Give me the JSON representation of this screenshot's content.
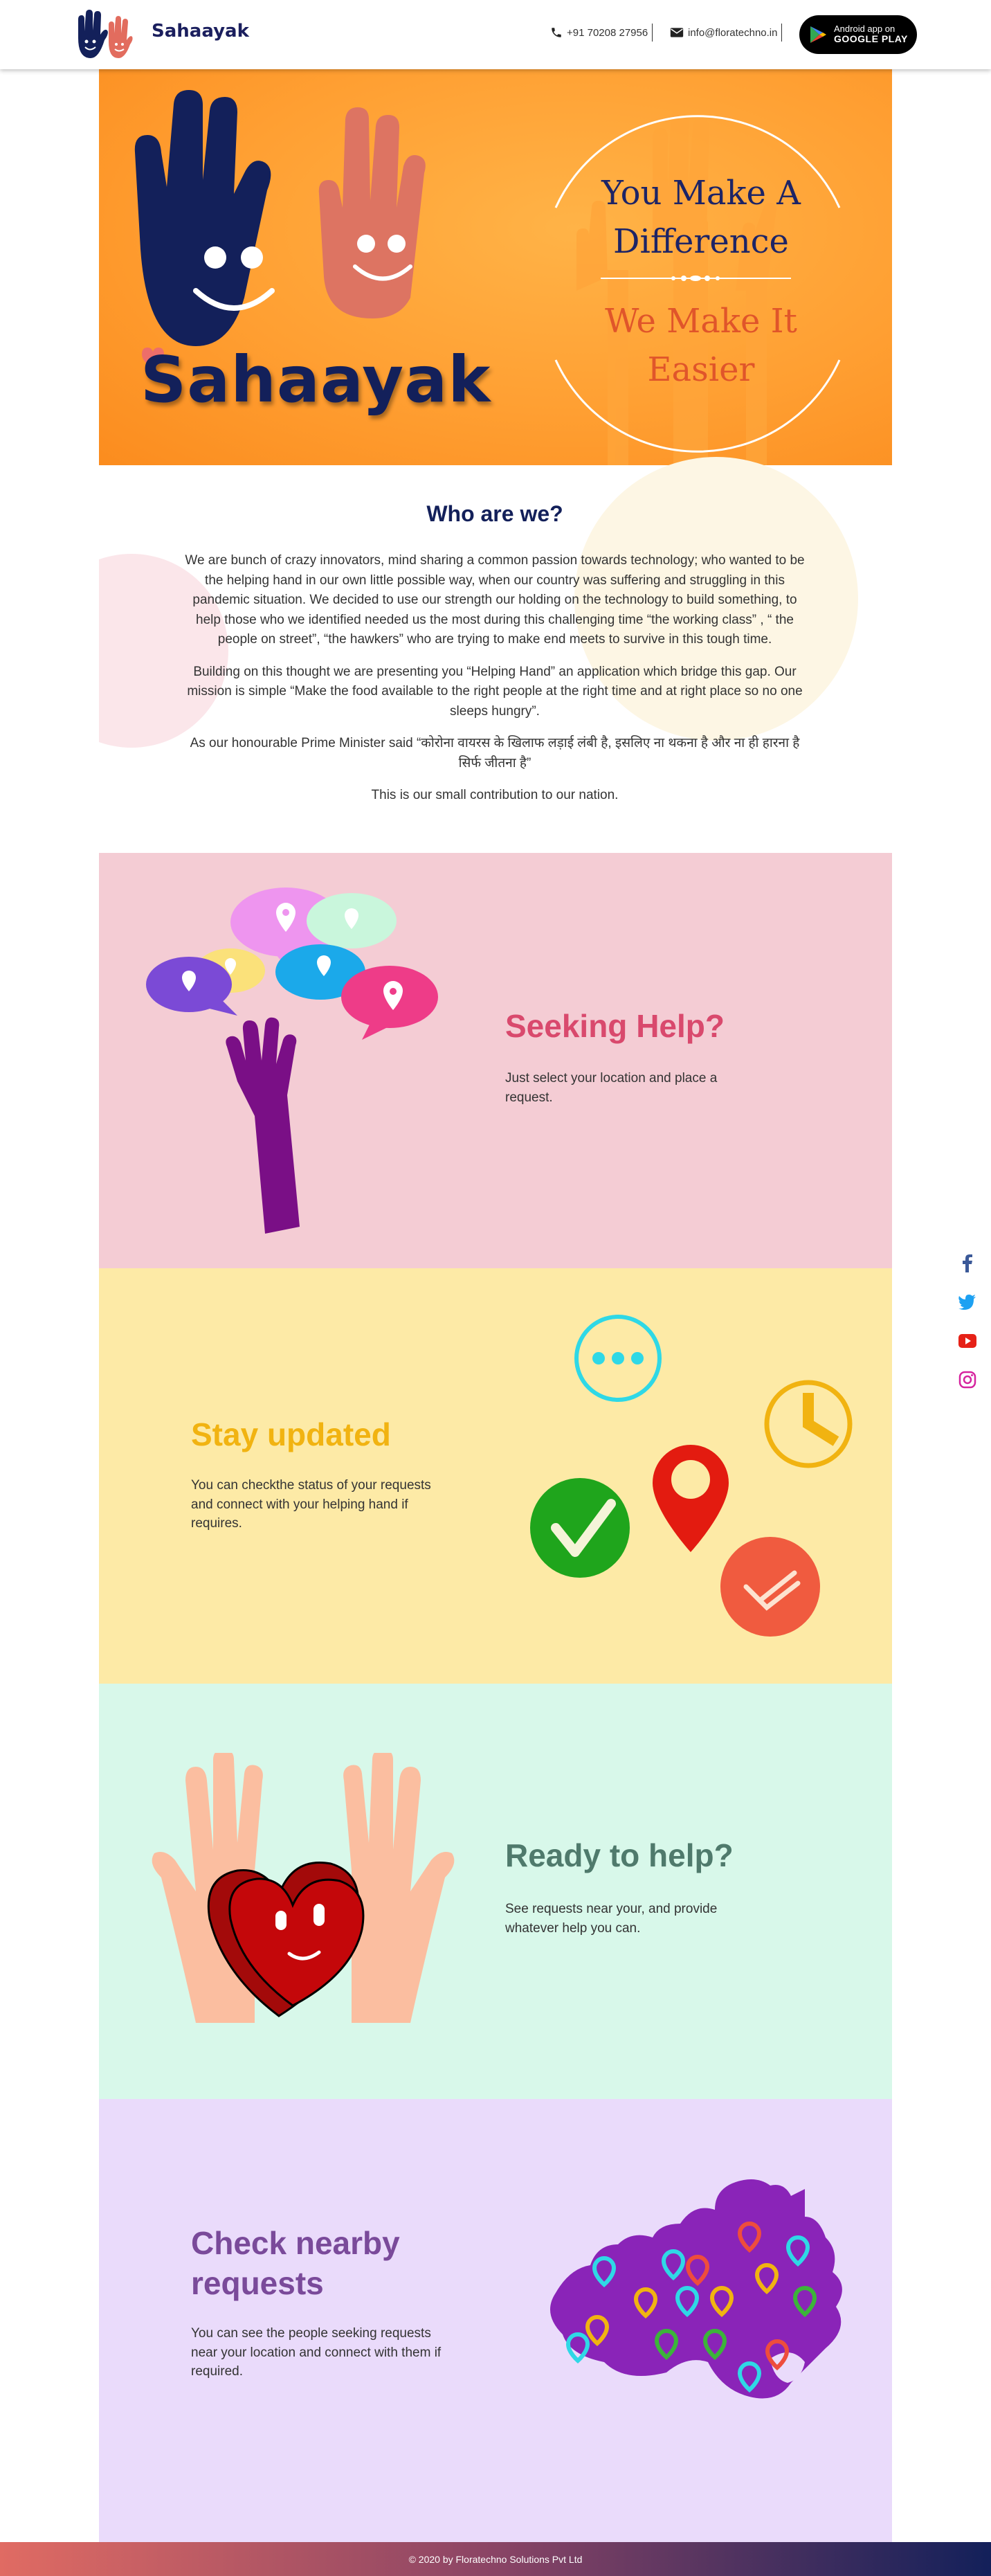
{
  "header": {
    "logo_text": "Sahaayak",
    "phone": "+91 70208 27956",
    "email": "info@floratechno.in",
    "store_line1": "Android app on",
    "store_line2": "GOOGLE PLAY"
  },
  "hero": {
    "brand": "Sahaayak",
    "tagline1": "You Make A Difference",
    "tagline2": "We Make It Easier"
  },
  "about": {
    "title": "Who are we?",
    "p1": "We are bunch of crazy innovators, mind sharing a common passion towards technology; who wanted to be the helping hand in our own little possible way, when our country was suffering and struggling in this pandemic situation. We decided to use our strength our holding on the technology to build something, to help those who we identified needed us the most during this challenging time “the working class” , “ the people on street”, “the hawkers” who are trying to make end meets to survive in this tough time.",
    "p2": "Building on this thought we are presenting you “Helping Hand” an application which bridge this gap. Our mission is simple “Make the food available to the right people at the right time and at right place so no one sleeps hungry”.",
    "p3": "As our honourable Prime Minister said “कोरोना वायरस के खिलाफ लड़ाई लंबी है, इसलिए ना थकना है और ना ही हारना है सिर्फ जीतना है”",
    "p4": "This is our small contribution to our nation."
  },
  "sections": [
    {
      "title": "Seeking Help?",
      "text": "Just select your location and place a request.",
      "color": "#d9496d"
    },
    {
      "title": "Stay updated",
      "text": "You can checkthe status of your requests and connect with your helping hand if requires.",
      "color": "#f1b311"
    },
    {
      "title": "Ready to help?",
      "text": "See requests near your, and provide whatever help you can.",
      "color": "#4f7a6c"
    },
    {
      "title": "Check nearby requests",
      "text": "You can see the people seeking requests near your location and connect with them if required.",
      "color": "#7a4a9a"
    }
  ],
  "social": {
    "icons": [
      "facebook-icon",
      "twitter-icon",
      "youtube-icon",
      "instagram-icon"
    ],
    "colors": [
      "#3b5998",
      "#1da1f2",
      "#e62117",
      "#d6249f"
    ]
  },
  "footer": {
    "copyright": "©  2020 by Floratechno Solutions Pvt Ltd"
  }
}
